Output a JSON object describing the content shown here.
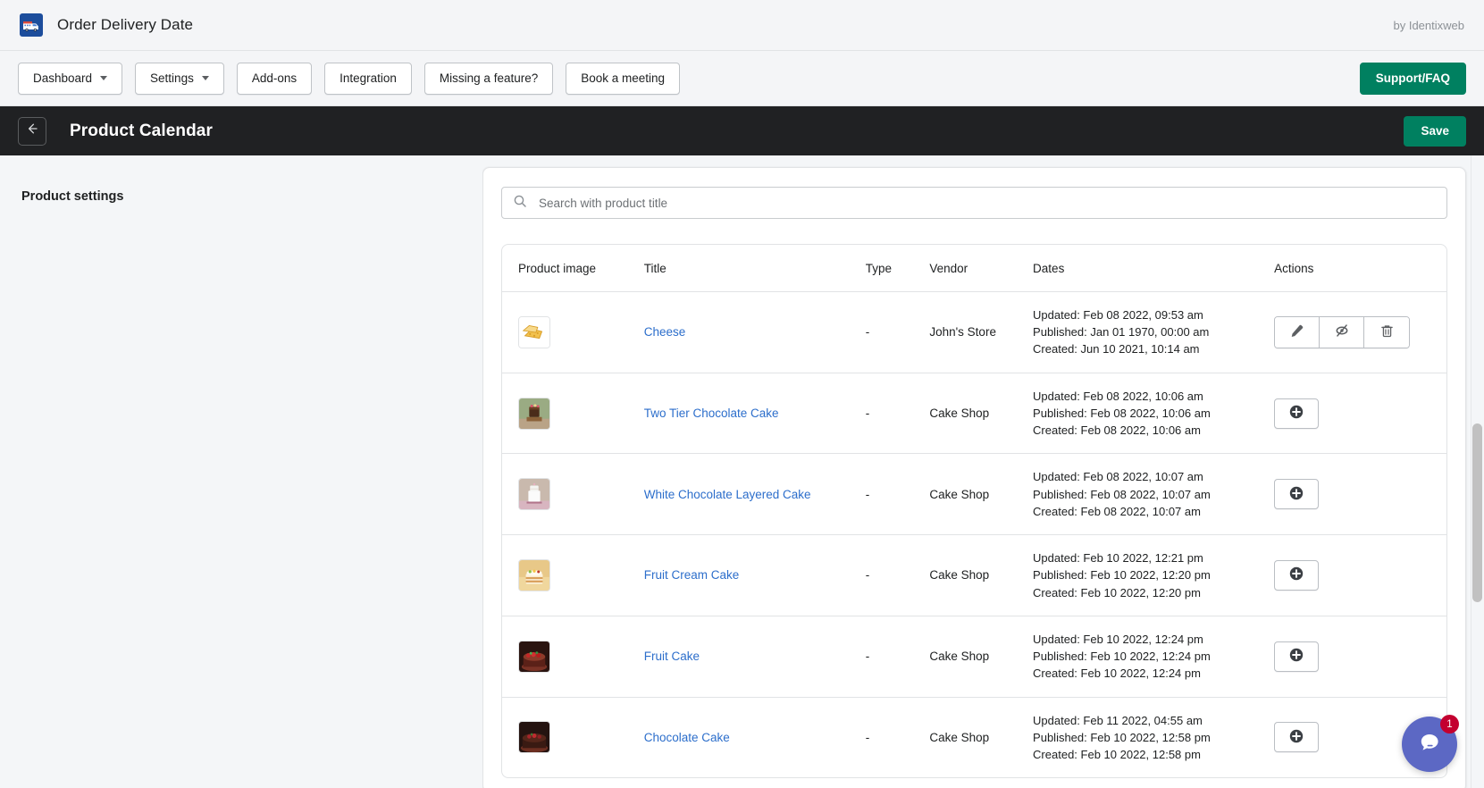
{
  "appbar": {
    "icon": "delivery-truck-calendar-icon",
    "title": "Order Delivery Date",
    "by_line": "by Identixweb"
  },
  "navbar": {
    "items": [
      {
        "label": "Dashboard",
        "has_caret": true
      },
      {
        "label": "Settings",
        "has_caret": true
      },
      {
        "label": "Add-ons",
        "has_caret": false
      },
      {
        "label": "Integration",
        "has_caret": false
      },
      {
        "label": "Missing a feature?",
        "has_caret": false
      },
      {
        "label": "Book a meeting",
        "has_caret": false
      }
    ],
    "support_label": "Support/FAQ",
    "accent_color": "#008060"
  },
  "page_header": {
    "back_icon": "arrow-left-icon",
    "title": "Product Calendar",
    "save_label": "Save",
    "background": "#202123"
  },
  "left_panel": {
    "heading": "Product settings"
  },
  "search": {
    "icon": "search-icon",
    "placeholder": "Search with product title",
    "value": ""
  },
  "table": {
    "columns": [
      "Product image",
      "Title",
      "Type",
      "Vendor",
      "Dates",
      "Actions"
    ],
    "rows": [
      {
        "thumb": "cheese-thumbnail",
        "thumb_emoji": "🧀",
        "title": "Cheese",
        "type": "-",
        "vendor": "John's Store",
        "updated": "Updated: Feb 08 2022, 09:53 am",
        "published": "Published: Jan 01 1970, 00:00 am",
        "created": "Created: Jun 10 2021, 10:14 am",
        "actions": [
          "edit-icon",
          "eye-off-icon",
          "trash-icon"
        ]
      },
      {
        "thumb": "two-tier-chocolate-cake-thumbnail",
        "thumb_emoji": "🎂",
        "title": "Two Tier Chocolate Cake",
        "type": "-",
        "vendor": "Cake Shop",
        "updated": "Updated: Feb 08 2022, 10:06 am",
        "published": "Published: Feb 08 2022, 10:06 am",
        "created": "Created: Feb 08 2022, 10:06 am",
        "actions": [
          "plus-circle-icon"
        ]
      },
      {
        "thumb": "white-chocolate-layered-cake-thumbnail",
        "thumb_emoji": "🍰",
        "title": "White Chocolate Layered Cake",
        "type": "-",
        "vendor": "Cake Shop",
        "updated": "Updated: Feb 08 2022, 10:07 am",
        "published": "Published: Feb 08 2022, 10:07 am",
        "created": "Created: Feb 08 2022, 10:07 am",
        "actions": [
          "plus-circle-icon"
        ]
      },
      {
        "thumb": "fruit-cream-cake-thumbnail",
        "thumb_emoji": "🥞",
        "title": "Fruit Cream Cake",
        "type": "-",
        "vendor": "Cake Shop",
        "updated": "Updated: Feb 10 2022, 12:21 pm",
        "published": "Published: Feb 10 2022, 12:20 pm",
        "created": "Created: Feb 10 2022, 12:20 pm",
        "actions": [
          "plus-circle-icon"
        ]
      },
      {
        "thumb": "fruit-cake-thumbnail",
        "thumb_emoji": "🍓",
        "title": "Fruit Cake",
        "type": "-",
        "vendor": "Cake Shop",
        "updated": "Updated: Feb 10 2022, 12:24 pm",
        "published": "Published: Feb 10 2022, 12:24 pm",
        "created": "Created: Feb 10 2022, 12:24 pm",
        "actions": [
          "plus-circle-icon"
        ]
      },
      {
        "thumb": "chocolate-cake-thumbnail",
        "thumb_emoji": "🍫",
        "title": "Chocolate Cake",
        "type": "-",
        "vendor": "Cake Shop",
        "updated": "Updated: Feb 11 2022, 04:55 am",
        "published": "Published: Feb 10 2022, 12:58 pm",
        "created": "Created: Feb 10 2022, 12:58 pm",
        "actions": [
          "plus-circle-icon"
        ]
      }
    ]
  },
  "chat_widget": {
    "icon": "chat-bubble-icon",
    "badge_count": "1",
    "color": "#5c68c4",
    "badge_color": "#c3002f"
  }
}
